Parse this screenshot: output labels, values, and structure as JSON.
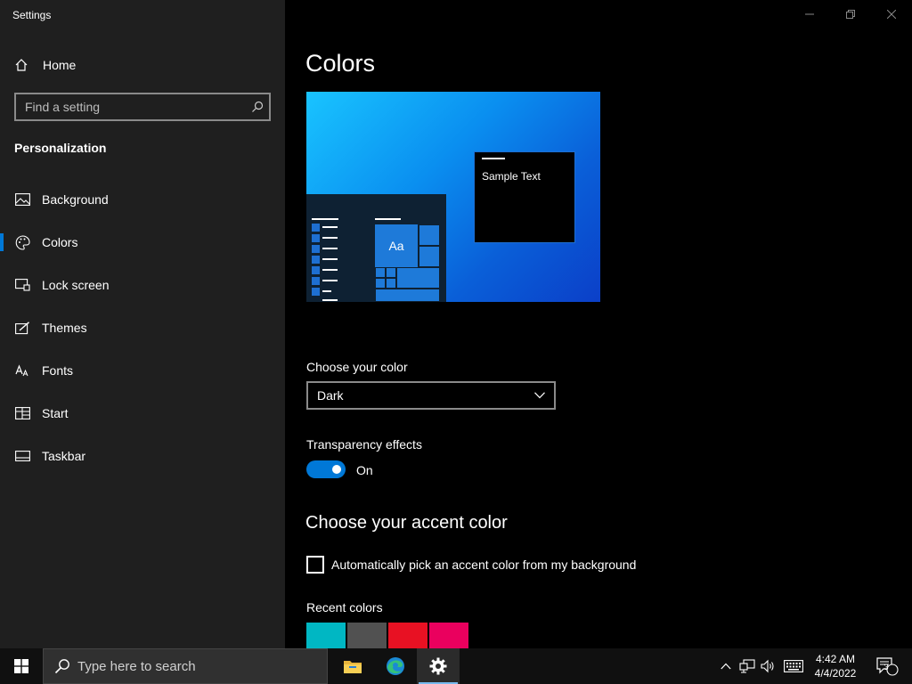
{
  "app": {
    "title": "Settings"
  },
  "sidebar": {
    "home_label": "Home",
    "search_placeholder": "Find a setting",
    "section_title": "Personalization",
    "items": [
      {
        "label": "Background",
        "icon": "image-icon"
      },
      {
        "label": "Colors",
        "icon": "palette-icon",
        "active": true
      },
      {
        "label": "Lock screen",
        "icon": "lock-screen-icon"
      },
      {
        "label": "Themes",
        "icon": "brush-icon"
      },
      {
        "label": "Fonts",
        "icon": "font-icon"
      },
      {
        "label": "Start",
        "icon": "start-icon"
      },
      {
        "label": "Taskbar",
        "icon": "taskbar-icon"
      }
    ]
  },
  "main": {
    "title": "Colors",
    "preview": {
      "sample_text": "Sample Text",
      "tile_text": "Aa"
    },
    "choose_color_label": "Choose your color",
    "choose_color_value": "Dark",
    "transparency_label": "Transparency effects",
    "transparency_state": "On",
    "accent_heading": "Choose your accent color",
    "auto_accent_label": "Automatically pick an accent color from my background",
    "recent_colors_label": "Recent colors",
    "recent_colors": [
      "#00b7c3",
      "#515151",
      "#e81123",
      "#ea005e"
    ]
  },
  "taskbar": {
    "search_placeholder": "Type here to search",
    "time": "4:42 AM",
    "date": "4/4/2022",
    "notification_count": "3"
  },
  "colors": {
    "accent": "#0078d7",
    "sidebar_bg": "#1f1f1f",
    "main_bg": "#000000"
  }
}
